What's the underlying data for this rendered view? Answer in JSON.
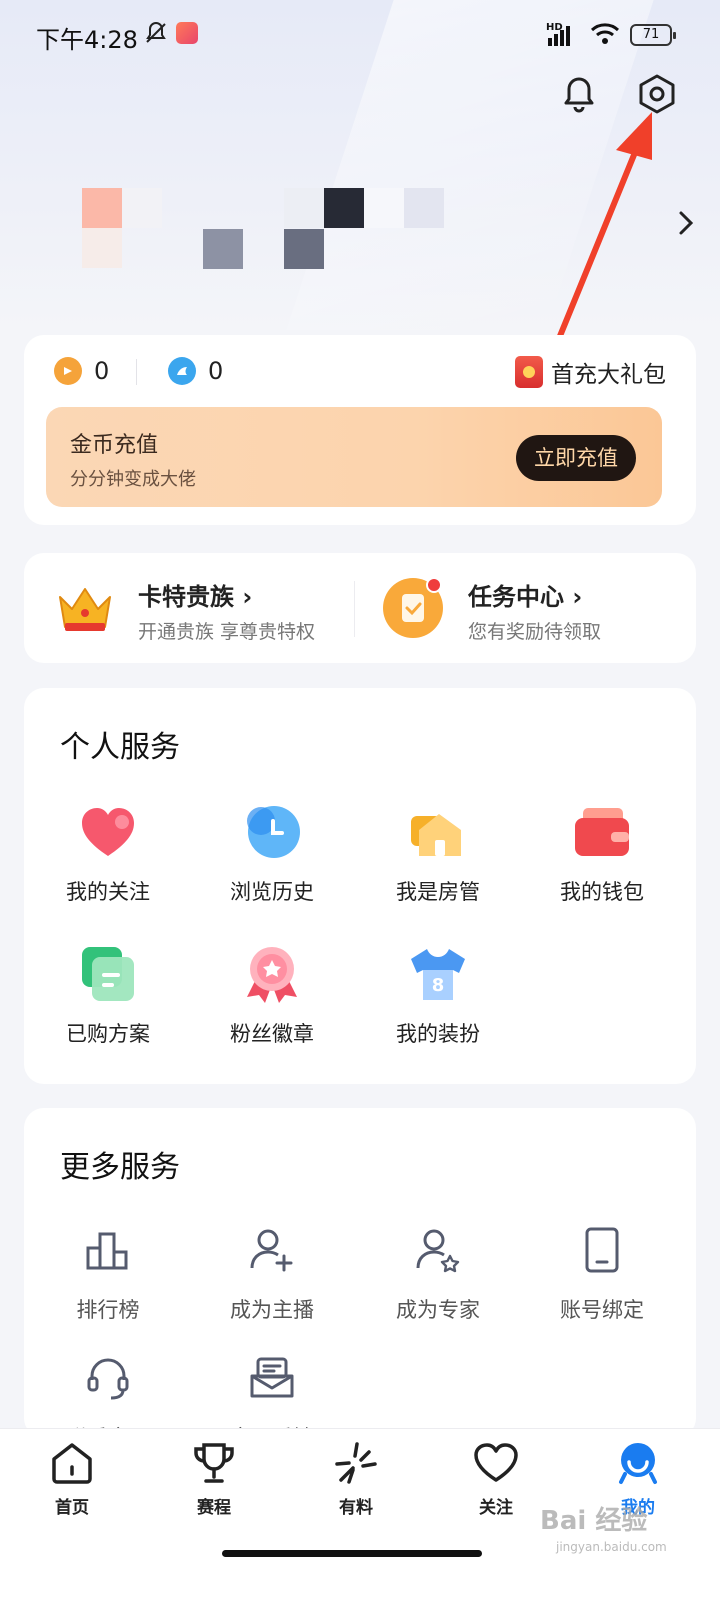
{
  "status_bar": {
    "time": "下午4:28",
    "network_label": "HD",
    "battery": "71"
  },
  "header": {
    "bell_icon": "bell-icon",
    "settings_icon": "gear-icon"
  },
  "wallet": {
    "coin_a_value": "0",
    "coin_b_value": "0",
    "gift_label": "首充大礼包",
    "recharge_title": "金币充值",
    "recharge_subtitle": "分分钟变成大佬",
    "recharge_button": "立即充值"
  },
  "vip": {
    "noble_title": "卡特贵族 ›",
    "noble_subtitle": "开通贵族 享尊贵特权",
    "task_title": "任务中心 ›",
    "task_subtitle": "您有奖励待领取"
  },
  "personal_services": {
    "title": "个人服务",
    "items": [
      {
        "label": "我的关注",
        "icon": "heart-icon"
      },
      {
        "label": "浏览历史",
        "icon": "clock-icon"
      },
      {
        "label": "我是房管",
        "icon": "house-icon"
      },
      {
        "label": "我的钱包",
        "icon": "wallet-icon"
      },
      {
        "label": "已购方案",
        "icon": "document-icon"
      },
      {
        "label": "粉丝徽章",
        "icon": "badge-icon"
      },
      {
        "label": "我的装扮",
        "icon": "jersey-icon"
      }
    ]
  },
  "more_services": {
    "title": "更多服务",
    "items": [
      {
        "label": "排行榜",
        "icon": "ranking-icon"
      },
      {
        "label": "成为主播",
        "icon": "add-user-icon"
      },
      {
        "label": "成为专家",
        "icon": "expert-user-icon"
      },
      {
        "label": "账号绑定",
        "icon": "tablet-icon"
      },
      {
        "label": "联系客服",
        "icon": "headset-icon"
      },
      {
        "label": "意见反馈",
        "icon": "feedback-icon"
      }
    ]
  },
  "bottom_nav": {
    "items": [
      {
        "label": "首页",
        "icon": "home-icon"
      },
      {
        "label": "赛程",
        "icon": "trophy-icon"
      },
      {
        "label": "有料",
        "icon": "sparkle-icon"
      },
      {
        "label": "关注",
        "icon": "heart-outline-icon"
      },
      {
        "label": "我的",
        "icon": "profile-icon",
        "active": true
      }
    ]
  },
  "watermark": {
    "brand": "Bai 经验",
    "url": "jingyan.baidu.com"
  },
  "colors": {
    "accent": "#1a7cf0",
    "annotation_arrow": "#f0402a",
    "recharge_button_bg": "#201612"
  }
}
